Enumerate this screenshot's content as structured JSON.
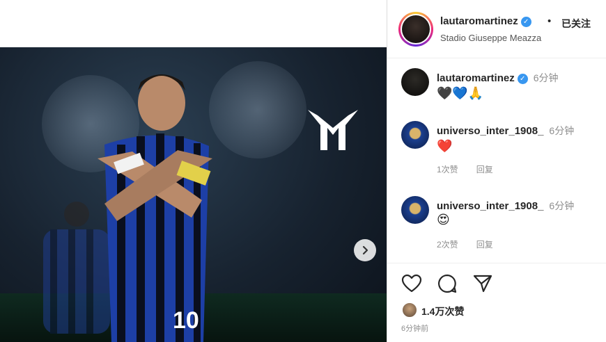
{
  "header": {
    "username": "lautaromartinez",
    "dot": "•",
    "follow_status": "已关注",
    "location": "Stadio Giuseppe Meazza"
  },
  "media": {
    "next_icon": "chevron-right-icon",
    "watermark": "LM"
  },
  "comments": [
    {
      "username": "lautaromartinez",
      "time": "6分钟",
      "text": "🖤💙🙏",
      "meta": []
    },
    {
      "username": "universo_inter_1908_",
      "time": "6分钟",
      "text": "❤️",
      "meta": [
        "1次赞",
        "回复"
      ]
    },
    {
      "username": "universo_inter_1908_",
      "time": "6分钟",
      "text": "😍",
      "meta": [
        "2次赞",
        "回复"
      ]
    }
  ],
  "actions": {
    "icons": [
      "heart-icon",
      "comment-icon",
      "share-icon"
    ]
  },
  "likes": {
    "count_text": "1.4万次赞"
  },
  "posted_time": "6分钟前",
  "colors": {
    "verified": "#3897f0",
    "text": "#262626",
    "muted": "#8e8e8e"
  }
}
